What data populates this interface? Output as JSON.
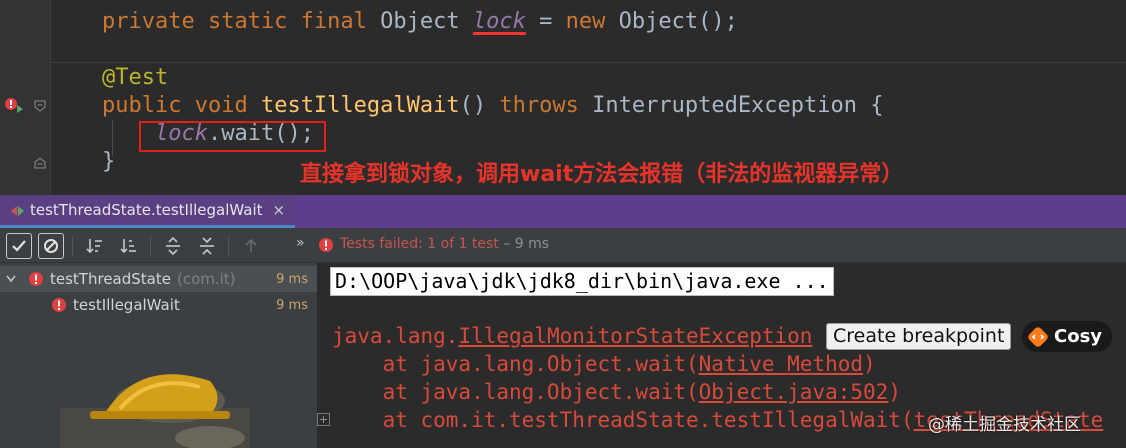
{
  "editor": {
    "line1": {
      "p1": "private static final",
      "p2": " Object ",
      "p3": "lock",
      "p4": " = ",
      "p5": "new",
      "p6": " Object();"
    },
    "annotation": "@Test",
    "method_sig": {
      "p1": "public void",
      "p2": " ",
      "p3": "testIllegalWait",
      "p4": "() ",
      "p5": "throws",
      "p6": " InterruptedException {"
    },
    "body": {
      "p1": "lock",
      "p2": ".wait();"
    },
    "close_brace": "}",
    "comment_overlay": "直接拿到锁对象，调用wait方法会报错（非法的监视器异常）"
  },
  "run_tab": {
    "label": "testThreadState.testIllegalWait",
    "close": "×"
  },
  "toolbar": {
    "more": "»",
    "status": "Tests failed: 1 of 1 test",
    "status_time": " – 9 ms"
  },
  "tree": {
    "rows": [
      {
        "name": "testThreadState",
        "pkg": "(com.it)",
        "time": "9 ms"
      },
      {
        "name": "testIllegalWait",
        "time": "9 ms"
      }
    ]
  },
  "console": {
    "command": "D:\\OOP\\java\\jdk\\jdk8_dir\\bin\\java.exe ...",
    "exception_pkg": "java.lang.",
    "exception_name": "IllegalMonitorStateException",
    "stack": [
      {
        "prefix": "    at java.lang.Object.wait(",
        "link": "Native Method",
        "suffix": ")"
      },
      {
        "prefix": "    at java.lang.Object.wait(",
        "link": "Object.java:502",
        "suffix": ")"
      },
      {
        "prefix": "    at com.it.testThreadState.testIllegalWait(",
        "link": "testThreadState",
        "suffix": ""
      }
    ],
    "tooltip": "Create breakpoint",
    "cosy": "Cosy"
  },
  "watermark": "@稀土掘金技术社区",
  "colors": {
    "keyword": "#cc7832",
    "field": "#9876aa",
    "method": "#ffc66d",
    "error": "#d84a3a",
    "tab_bar": "#5e3d8a"
  }
}
